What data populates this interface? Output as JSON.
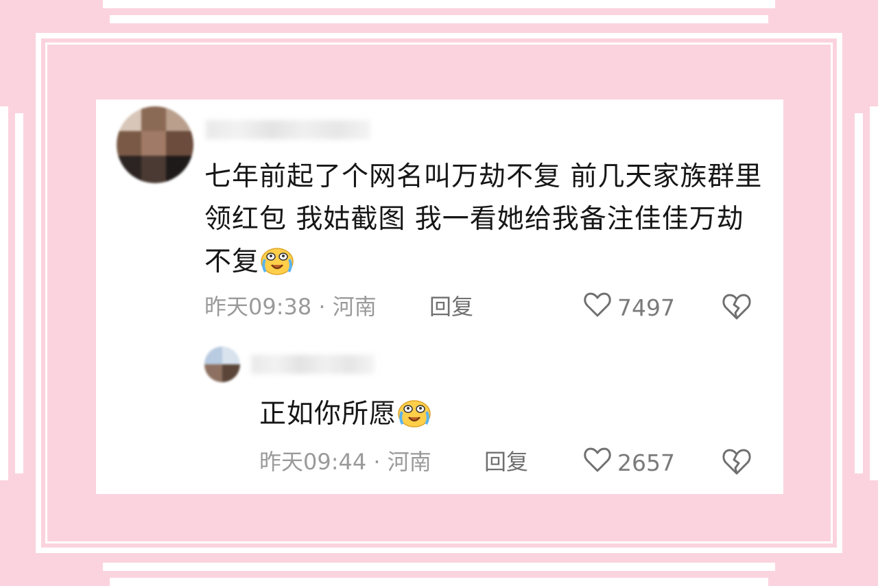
{
  "colors": {
    "background": "#fbd3de",
    "card": "#ffffff",
    "text": "#161616",
    "meta": "#9a9a9a"
  },
  "comment": {
    "text": "七年前起了个网名叫万劫不复 前几天家族群里领红包 我姑截图 我一看她给我备注佳佳万劫不复",
    "emoji": "crying-laughing-face-icon",
    "time": "昨天09:38",
    "location": "河南",
    "reply_label": "回复",
    "likes": "7497"
  },
  "reply": {
    "text": "正如你所愿",
    "emoji": "crying-laughing-face-icon",
    "time": "昨天09:44",
    "location": "河南",
    "reply_label": "回复",
    "likes": "2657"
  }
}
